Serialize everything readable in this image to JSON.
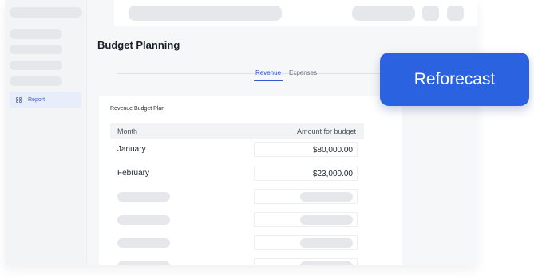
{
  "sidebar": {
    "active_item": {
      "label": "Report",
      "icon": "grid-icon"
    }
  },
  "main": {
    "page_title": "Budget Planning",
    "tabs": [
      {
        "label": "Revenue",
        "active": true
      },
      {
        "label": "Expenses",
        "active": false
      }
    ]
  },
  "card": {
    "title": "Revenue Budget Plan",
    "columns": [
      "Month",
      "Amount for budget"
    ],
    "rows": [
      {
        "month": "January",
        "amount": "$80,000.00"
      },
      {
        "month": "February",
        "amount": "$23,000.00"
      }
    ]
  },
  "cta": {
    "label": "Reforecast"
  },
  "colors": {
    "accent": "#2a62e0",
    "tab_active": "#2f5bd3",
    "sidebar_active_bg": "#e7edfb"
  }
}
